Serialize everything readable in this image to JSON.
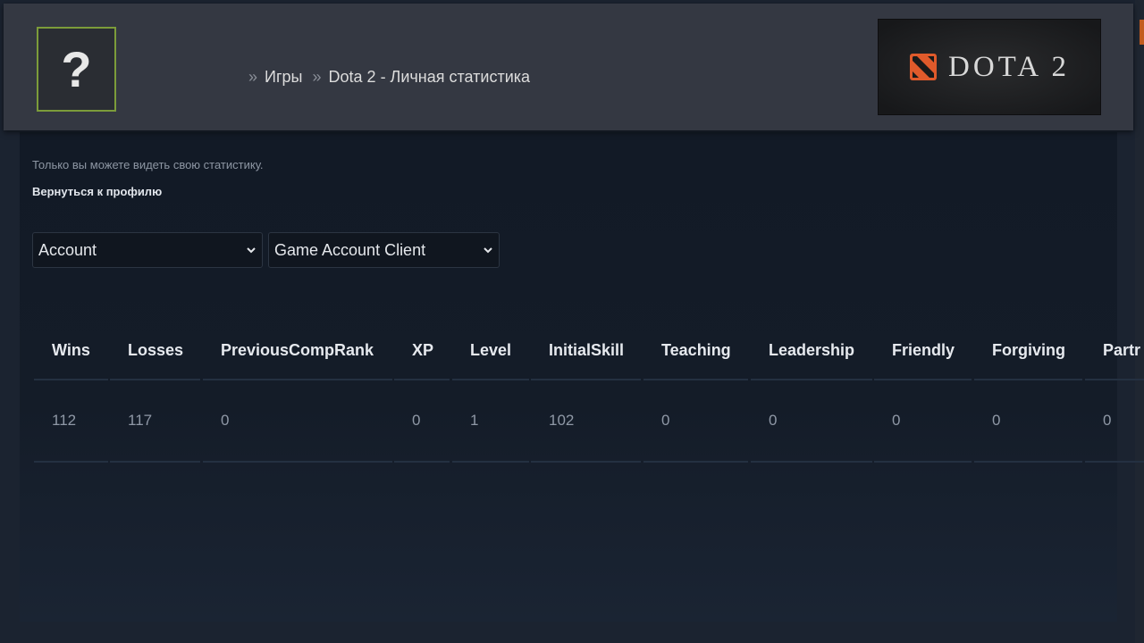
{
  "header": {
    "avatar_glyph": "?",
    "breadcrumb": {
      "sep1": "»",
      "games": "Игры",
      "sep2": "»",
      "current": "Dota 2 - Личная статистика"
    },
    "logo_text": "DOTA 2",
    "logo_color": "#e05a2b"
  },
  "notice": "Только вы можете видеть свою статистику.",
  "back_link": "Вернуться к профилю",
  "filters": {
    "select1": "Account",
    "select2": "Game Account Client"
  },
  "stats": {
    "columns": [
      "Wins",
      "Losses",
      "PreviousCompRank",
      "XP",
      "Level",
      "InitialSkill",
      "Teaching",
      "Leadership",
      "Friendly",
      "Forgiving",
      "Partr"
    ],
    "values": [
      "112",
      "117",
      "0",
      "0",
      "1",
      "102",
      "0",
      "0",
      "0",
      "0",
      "0"
    ]
  },
  "colors": {
    "header_bg": "#343842",
    "content_bg": "#121a26",
    "avatar_border": "#7c9c3a"
  }
}
